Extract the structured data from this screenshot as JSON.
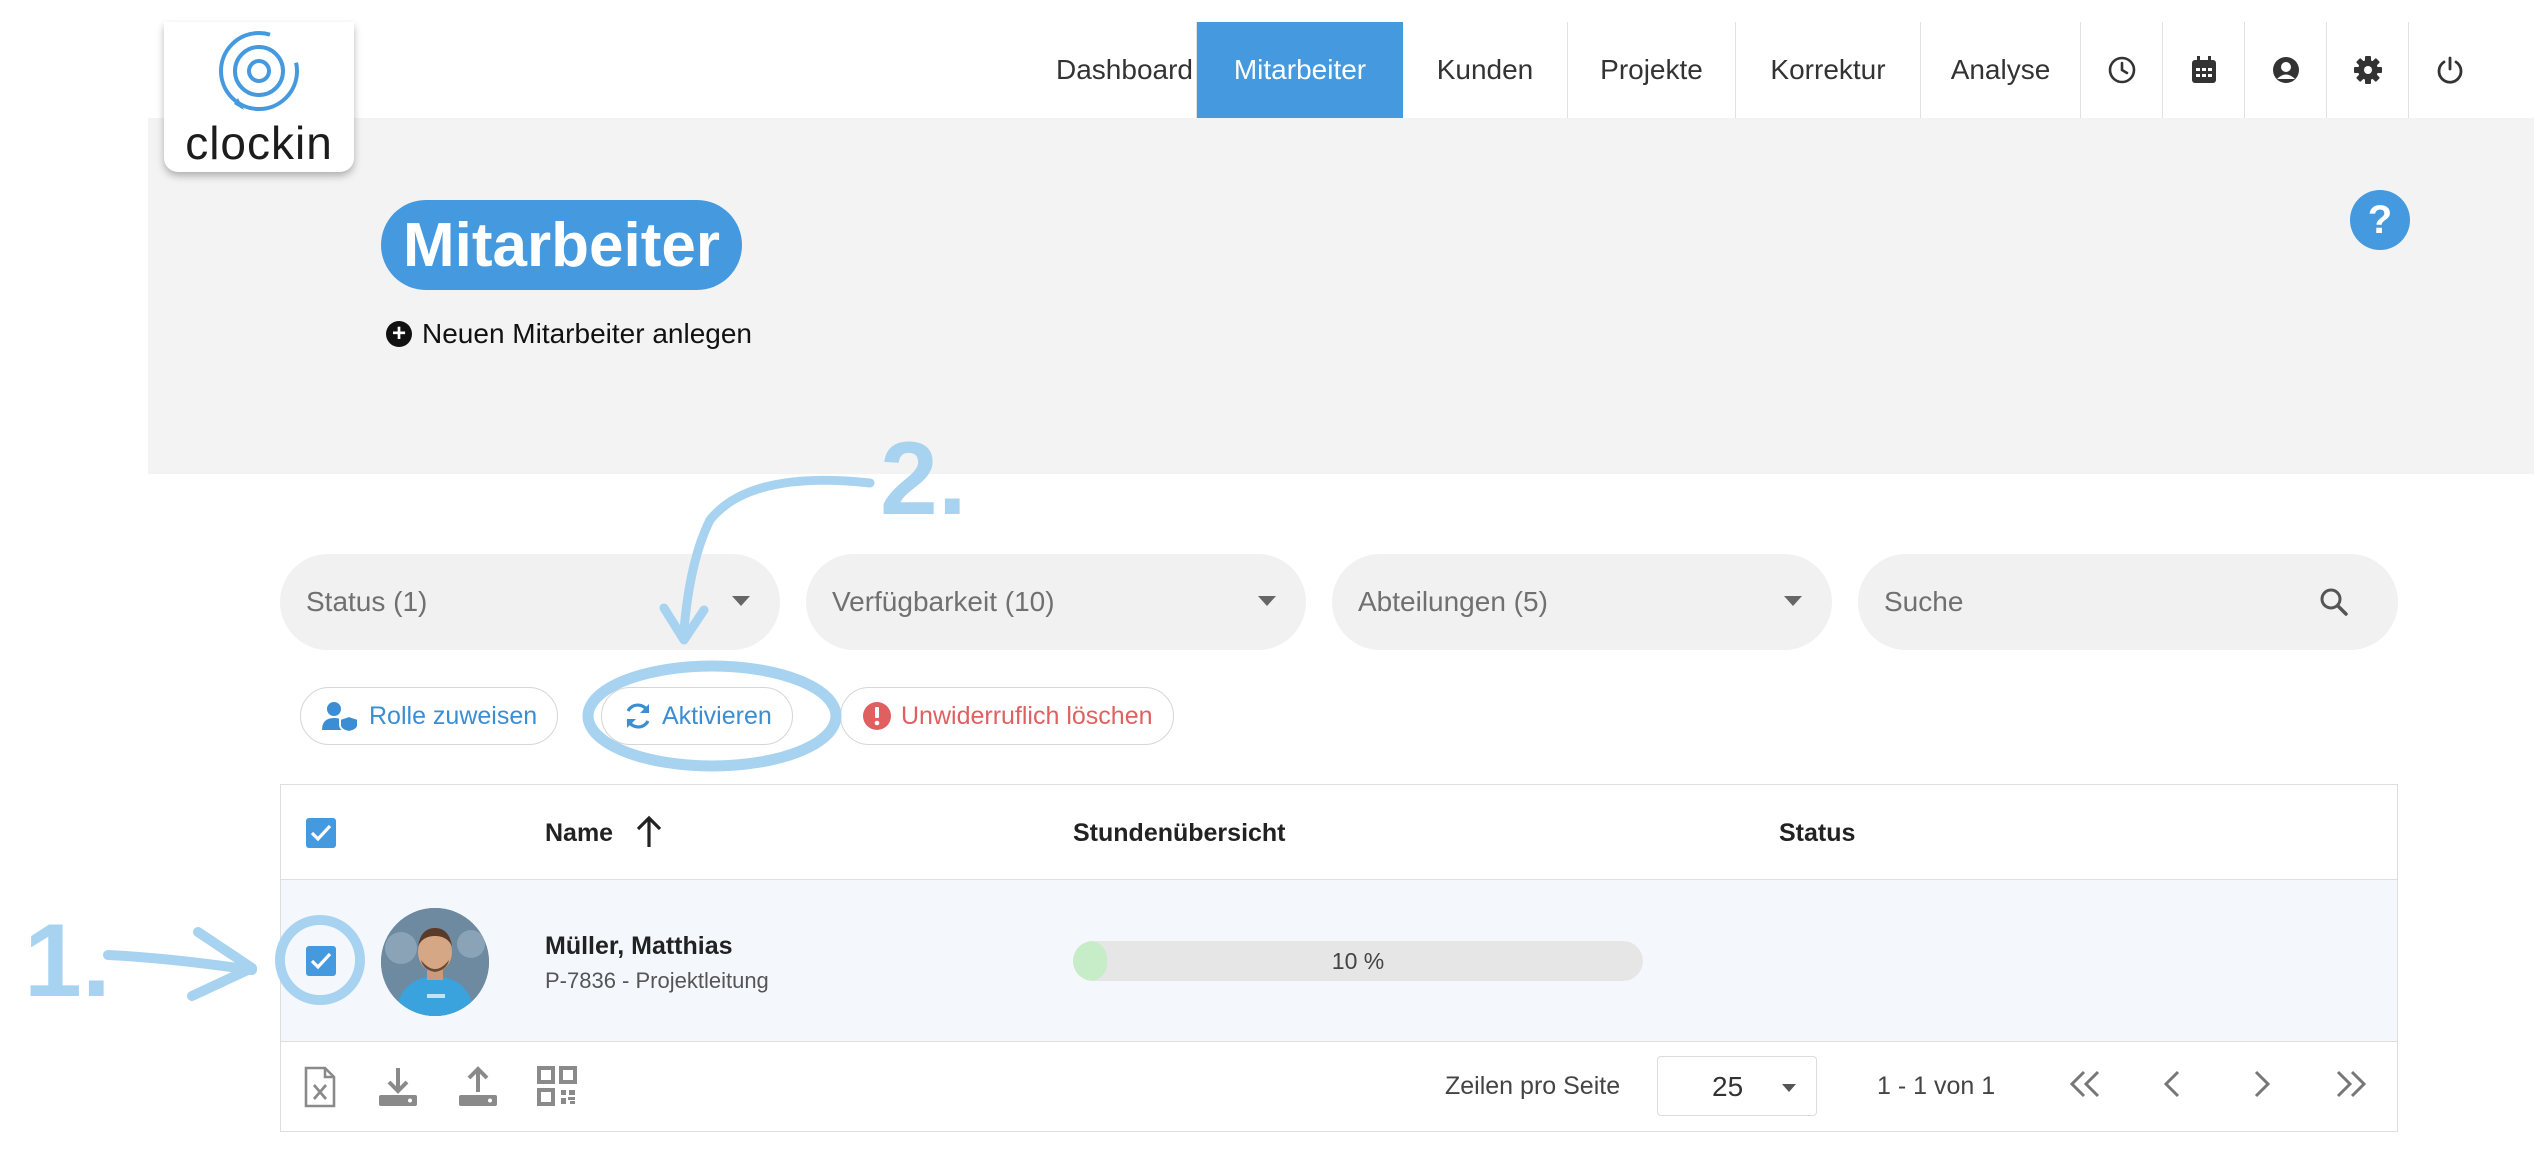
{
  "app": {
    "logo_text": "clockin",
    "accent": "#4599de"
  },
  "nav": {
    "items": [
      "Dashboard",
      "Mitarbeiter",
      "Kunden",
      "Projekte",
      "Korrektur",
      "Analyse"
    ],
    "active": "Mitarbeiter",
    "icons": [
      "clock-icon",
      "calendar-icon",
      "user-circle-icon",
      "gear-icon",
      "power-icon"
    ]
  },
  "header": {
    "title": "Mitarbeiter",
    "new_link": "Neuen Mitarbeiter anlegen",
    "help": "?"
  },
  "annotations": {
    "step1": "1.",
    "step2": "2."
  },
  "filters": {
    "status": "Status (1)",
    "availability": "Verfügbarkeit (10)",
    "departments": "Abteilungen (5)",
    "search_placeholder": "Suche"
  },
  "actions": {
    "assign_role": "Rolle zuweisen",
    "activate": "Aktivieren",
    "delete": "Unwiderruflich löschen"
  },
  "table": {
    "columns": {
      "name": "Name",
      "hours": "Stundenübersicht",
      "status": "Status"
    },
    "rows": [
      {
        "name": "Müller, Matthias",
        "subtitle": "P-7836 - Projektleitung",
        "hours_label": "10 %",
        "hours_fraction": 0.1,
        "status": "",
        "selected": true
      }
    ]
  },
  "footer": {
    "rows_per_page_label": "Zeilen pro Seite",
    "rows_per_page": "25",
    "range": "1 - 1 von 1",
    "icons": [
      "excel-export-icon",
      "download-icon",
      "upload-icon",
      "qr-code-icon"
    ]
  }
}
